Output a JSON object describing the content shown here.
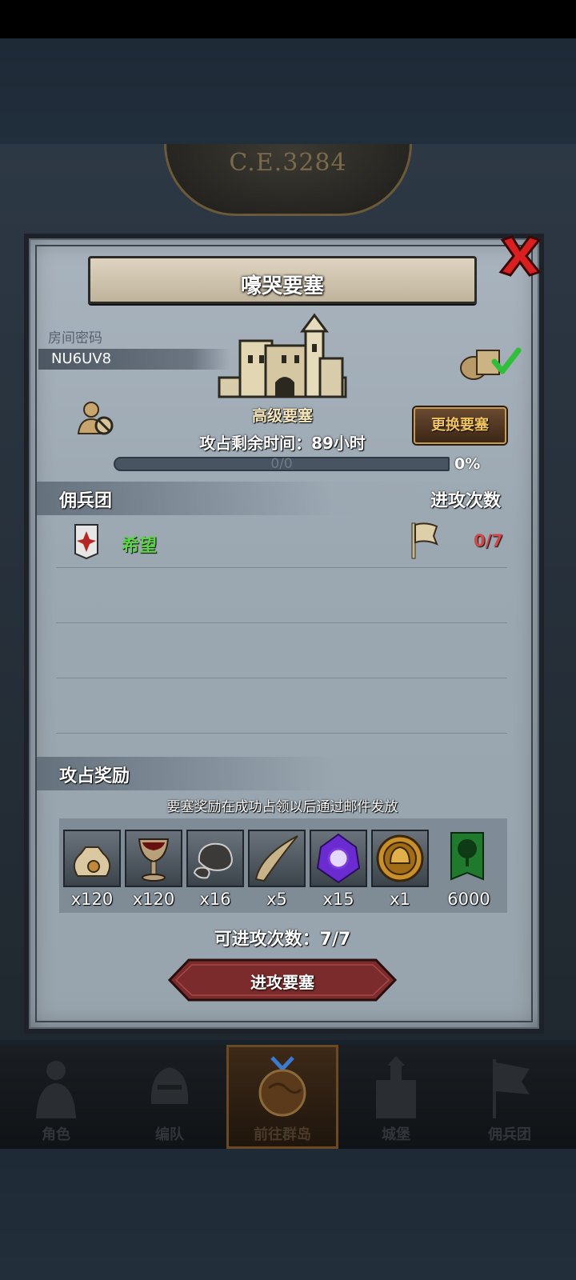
{
  "background": {
    "era": "C.E.3284"
  },
  "modal": {
    "title": "嚎哭要塞",
    "room_label": "房间密码",
    "room_code": "NU6UV8",
    "fort_level": "高级要塞",
    "time_left": "攻占剩余时间：89小时",
    "change_button": "更换要塞",
    "progress": {
      "value_text": "0/0",
      "percent": "0%",
      "fraction": 0
    },
    "mercs": {
      "header": "佣兵团",
      "count_header": "进攻次数",
      "rows": [
        {
          "name": "希望",
          "count": "0/7"
        }
      ]
    },
    "rewards": {
      "header": "攻占奖励",
      "note": "要塞奖励在成功占领以后通过邮件发放",
      "items": [
        {
          "icon": "sack-icon",
          "qty": "x120"
        },
        {
          "icon": "goblet-icon",
          "qty": "x120"
        },
        {
          "icon": "ore-icon",
          "qty": "x16"
        },
        {
          "icon": "horn-icon",
          "qty": "x5"
        },
        {
          "icon": "purple-crystal-icon",
          "qty": "x15"
        },
        {
          "icon": "helmet-medal-icon",
          "qty": "x1"
        },
        {
          "icon": "tree-banner-icon",
          "qty": "6000"
        }
      ]
    },
    "attacks_left": "可进攻次数：7/7",
    "attack_button": "进攻要塞"
  },
  "nav": {
    "items": [
      {
        "label": "角色"
      },
      {
        "label": "编队"
      },
      {
        "label": "前往群岛"
      },
      {
        "label": "城堡"
      },
      {
        "label": "佣兵团"
      }
    ],
    "active": "前往群岛"
  },
  "colors": {
    "merc_name": "#5dd24a",
    "merc_count": "#d04848",
    "change_button_text": "#f3c35e"
  }
}
